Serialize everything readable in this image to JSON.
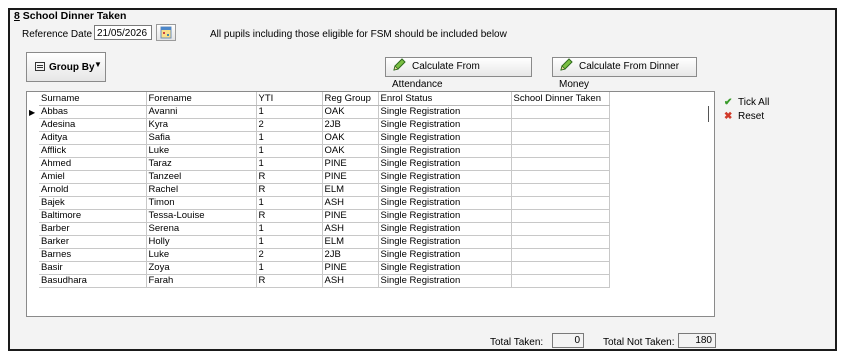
{
  "section": {
    "number": "8",
    "title": "School Dinner Taken"
  },
  "reference": {
    "label": "Reference Date",
    "value": "21/05/2026"
  },
  "info_text": "All pupils including those eligible for FSM should be included below",
  "group_by": {
    "label": "Group By"
  },
  "buttons": {
    "calc_attendance": "Calculate From Attendance",
    "calc_dinner_money": "Calculate From Dinner Money",
    "tick_all": "Tick All",
    "reset": "Reset"
  },
  "table": {
    "headers": [
      "Surname",
      "Forename",
      "YTI",
      "Reg Group",
      "Enrol Status",
      "School Dinner Taken"
    ],
    "rows": [
      [
        "Abbas",
        "Avanni",
        "1",
        "OAK",
        "Single Registration",
        ""
      ],
      [
        "Adesina",
        "Kyra",
        "2",
        "2JB",
        "Single Registration",
        ""
      ],
      [
        "Aditya",
        "Safia",
        "1",
        "OAK",
        "Single Registration",
        ""
      ],
      [
        "Afflick",
        "Luke",
        "1",
        "OAK",
        "Single Registration",
        ""
      ],
      [
        "Ahmed",
        "Taraz",
        "1",
        "PINE",
        "Single Registration",
        ""
      ],
      [
        "Amiel",
        "Tanzeel",
        "R",
        "PINE",
        "Single Registration",
        ""
      ],
      [
        "Arnold",
        "Rachel",
        "R",
        "ELM",
        "Single Registration",
        ""
      ],
      [
        "Bajek",
        "Timon",
        "1",
        "ASH",
        "Single Registration",
        ""
      ],
      [
        "Baltimore",
        "Tessa-Louise",
        "R",
        "PINE",
        "Single Registration",
        ""
      ],
      [
        "Barber",
        "Serena",
        "1",
        "ASH",
        "Single Registration",
        ""
      ],
      [
        "Barker",
        "Holly",
        "1",
        "ELM",
        "Single Registration",
        ""
      ],
      [
        "Barnes",
        "Luke",
        "2",
        "2JB",
        "Single Registration",
        ""
      ],
      [
        "Basir",
        "Zoya",
        "1",
        "PINE",
        "Single Registration",
        ""
      ],
      [
        "Basudhara",
        "Farah",
        "R",
        "ASH",
        "Single Registration",
        ""
      ]
    ]
  },
  "totals": {
    "taken_label": "Total Taken:",
    "taken_value": "0",
    "not_taken_label": "Total Not Taken:",
    "not_taken_value": "180"
  }
}
